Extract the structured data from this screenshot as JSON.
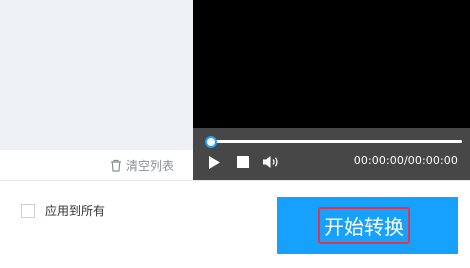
{
  "file_panel": {
    "clear_list_label": "清空列表",
    "clear_list_icon": "trash-icon"
  },
  "player": {
    "time": "00:00:00/00:00:00",
    "progress_fraction": 0,
    "controls": {
      "play_icon": "play-icon",
      "stop_icon": "stop-icon",
      "volume_icon": "volume-icon"
    }
  },
  "options": {
    "apply_all_label": "应用到所有",
    "apply_all_checked": false
  },
  "actions": {
    "start_label": "开始转换"
  },
  "colors": {
    "accent": "#17a1fe",
    "highlight_border": "#e2344a",
    "player_bg": "#000000",
    "control_bar": "#474747",
    "panel_bg": "#edf1f5"
  }
}
